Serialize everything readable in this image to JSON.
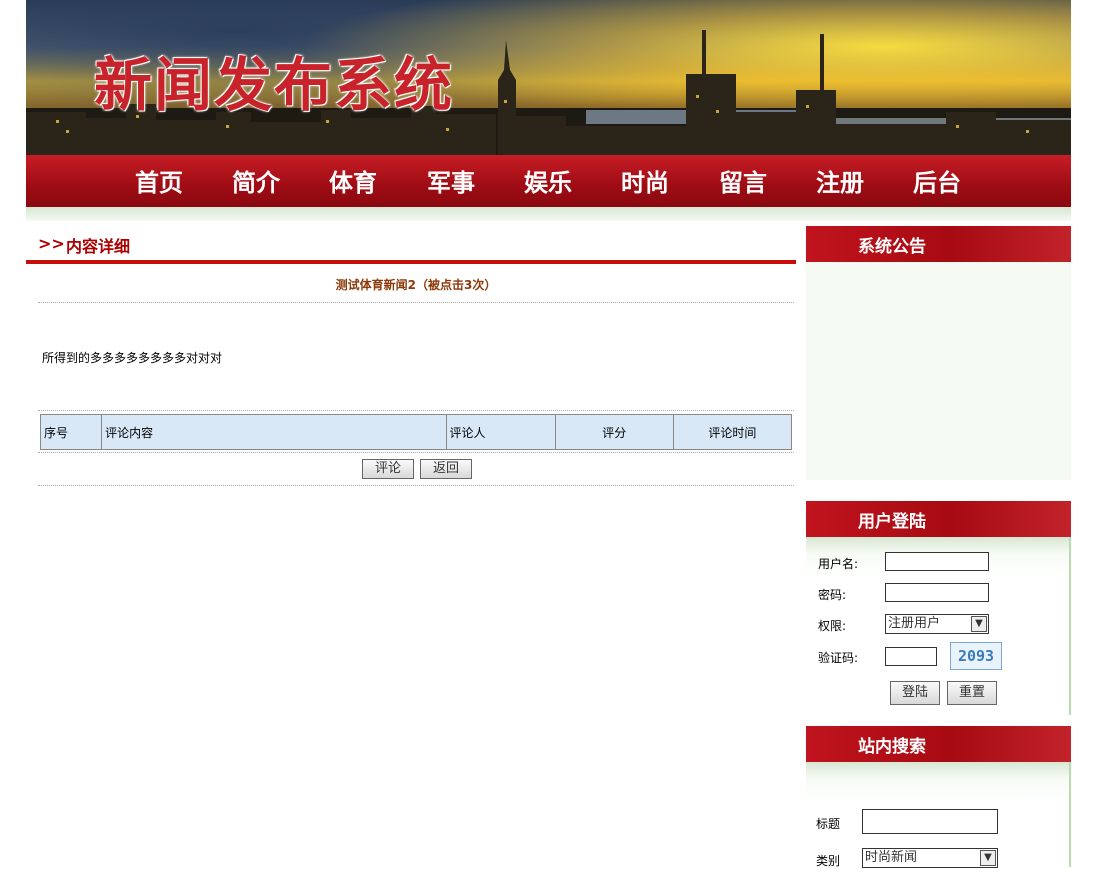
{
  "banner": {
    "title": "新闻发布系统"
  },
  "nav": [
    "首页",
    "简介",
    "体育",
    "军事",
    "娱乐",
    "时尚",
    "留言",
    "注册",
    "后台"
  ],
  "content": {
    "crumb_arrow": ">>",
    "crumb_label": "内容详细",
    "news_title": "测试体育新闻2（被点击3次）",
    "news_body": "所得到的多多多多多多多多对对对",
    "comment_headers": [
      "序号",
      "评论内容",
      "评论人",
      "评分",
      "评论时间"
    ],
    "comment_button": "评论",
    "back_button": "返回"
  },
  "notice": {
    "title": "系统公告"
  },
  "login": {
    "title": "用户登陆",
    "username_label": "用户名:",
    "username_value": "",
    "password_label": "密码:",
    "password_value": "",
    "role_label": "权限:",
    "role_value": "注册用户",
    "captcha_label": "验证码:",
    "captcha_value": "",
    "captcha_image_text": "2093",
    "login_button": "登陆",
    "reset_button": "重置"
  },
  "search": {
    "title": "站内搜索",
    "title_label": "标题",
    "title_value": "",
    "category_label": "类别",
    "category_value": "时尚新闻"
  },
  "colors": {
    "brand_red": "#b0101a",
    "header_blue": "#d9e8f7",
    "news_title": "#8b3a0a"
  }
}
